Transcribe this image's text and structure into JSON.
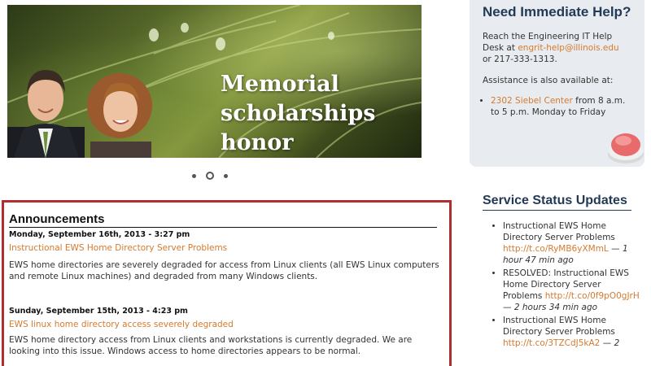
{
  "hero": {
    "headline_lines": [
      "Memorial",
      "scholarships",
      "honor employees"
    ]
  },
  "carousel": {
    "dot_count": 3,
    "active_index": 1
  },
  "help": {
    "title": "Need Immediate Help?",
    "intro_prefix": "Reach the Engineering IT Help Desk at ",
    "email": "engrit-help@illinois.edu",
    "intro_suffix": " or 217-333-1313.",
    "also": "Assistance is also available at:",
    "location_link": "2302 Siebel Center",
    "location_hours": " from 8 a.m. to 5 p.m. Monday to Friday"
  },
  "status": {
    "title": "Service Status Updates",
    "items": [
      {
        "text": "Instructional EWS Home Directory Server Problems ",
        "link": "http://t.co/RyMB6yXMmL",
        "ago": "1 hour 47 min ago"
      },
      {
        "text": "RESOLVED: Instructional EWS Home Directory Server Problems ",
        "link": "http://t.co/0f9pO0gJrH",
        "ago": "2 hours 34 min ago"
      },
      {
        "text": "Instructional EWS Home Directory Server Problems ",
        "link": "http://t.co/3TZCdJ5kA2",
        "ago": "2"
      }
    ]
  },
  "announcements": {
    "title": "Announcements",
    "items": [
      {
        "date": "Monday, September 16th, 2013 - 3:27 pm",
        "link": "Instructional EWS Home Directory Server Problems",
        "body": "EWS home directories are severely degraded for access from Linux clients (all EWS Linux computers and remote Linux machines) and degraded from many Windows clients."
      },
      {
        "date": "Sunday, September 15th, 2013 - 4:23 pm",
        "link": "EWS linux home directory access severely degraded",
        "body": "EWS home directory access from Linux clients and workstations is currently degraded. We are looking into this issue. Windows access to home directories appears to be normal."
      }
    ]
  }
}
